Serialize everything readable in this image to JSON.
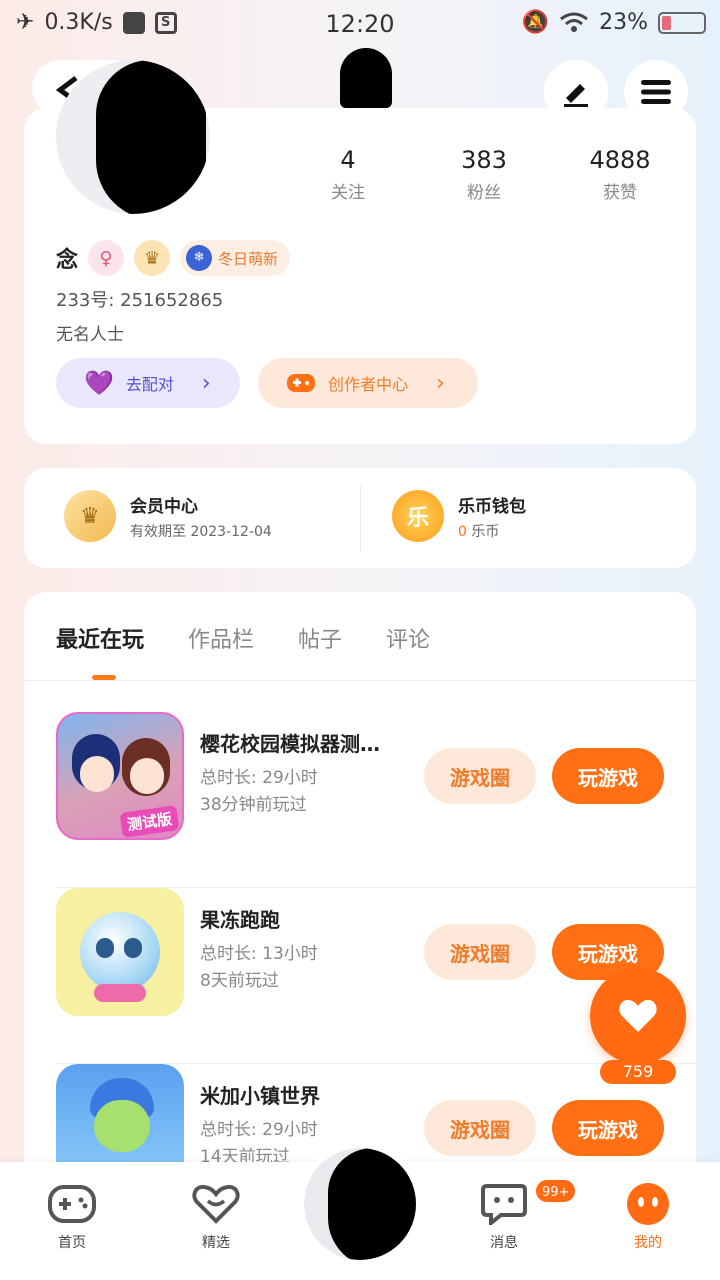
{
  "status_bar": {
    "speed": "0.3K/s",
    "time": "12:20",
    "battery": "23%"
  },
  "profile": {
    "following_count": "4",
    "following_label": "关注",
    "fans_count": "383",
    "fans_label": "粉丝",
    "likes_count": "4888",
    "likes_label": "获赞",
    "name": "念",
    "badge_text": "冬日萌新",
    "uid_label": "233号:",
    "uid_value": "251652865",
    "signature": "无名人士",
    "match_button": "去配对",
    "creator_button": "创作者中心"
  },
  "vip": {
    "member_title": "会员中心",
    "member_sub": "有效期至 2023-12-04",
    "wallet_title": "乐币钱包",
    "wallet_amount": "0",
    "wallet_unit": "乐币",
    "wallet_icon_char": "乐"
  },
  "tabs": [
    "最近在玩",
    "作品栏",
    "帖子",
    "评论"
  ],
  "games": [
    {
      "title": "樱花校园模拟器测…",
      "duration": "总时长:  29小时",
      "last_played": "38分钟前玩过",
      "icon_text": "测试版"
    },
    {
      "title": "果冻跑跑",
      "duration": "总时长:  13小时",
      "last_played": "8天前玩过",
      "icon_text": ""
    },
    {
      "title": "米加小镇世界",
      "duration": "总时长:  29小时",
      "last_played": "14天前玩过",
      "icon_text": ""
    }
  ],
  "game_buttons": {
    "circle": "游戏圈",
    "play": "玩游戏"
  },
  "like_count": "759",
  "bottom_nav": {
    "home": "首页",
    "featured": "精选",
    "messages": "消息",
    "messages_badge": "99+",
    "mine": "我的"
  },
  "colors": {
    "accent": "#ff7014",
    "accent_light": "#fde8da",
    "match_bg": "#e8e7fb",
    "match_fg": "#5b4ed6"
  }
}
